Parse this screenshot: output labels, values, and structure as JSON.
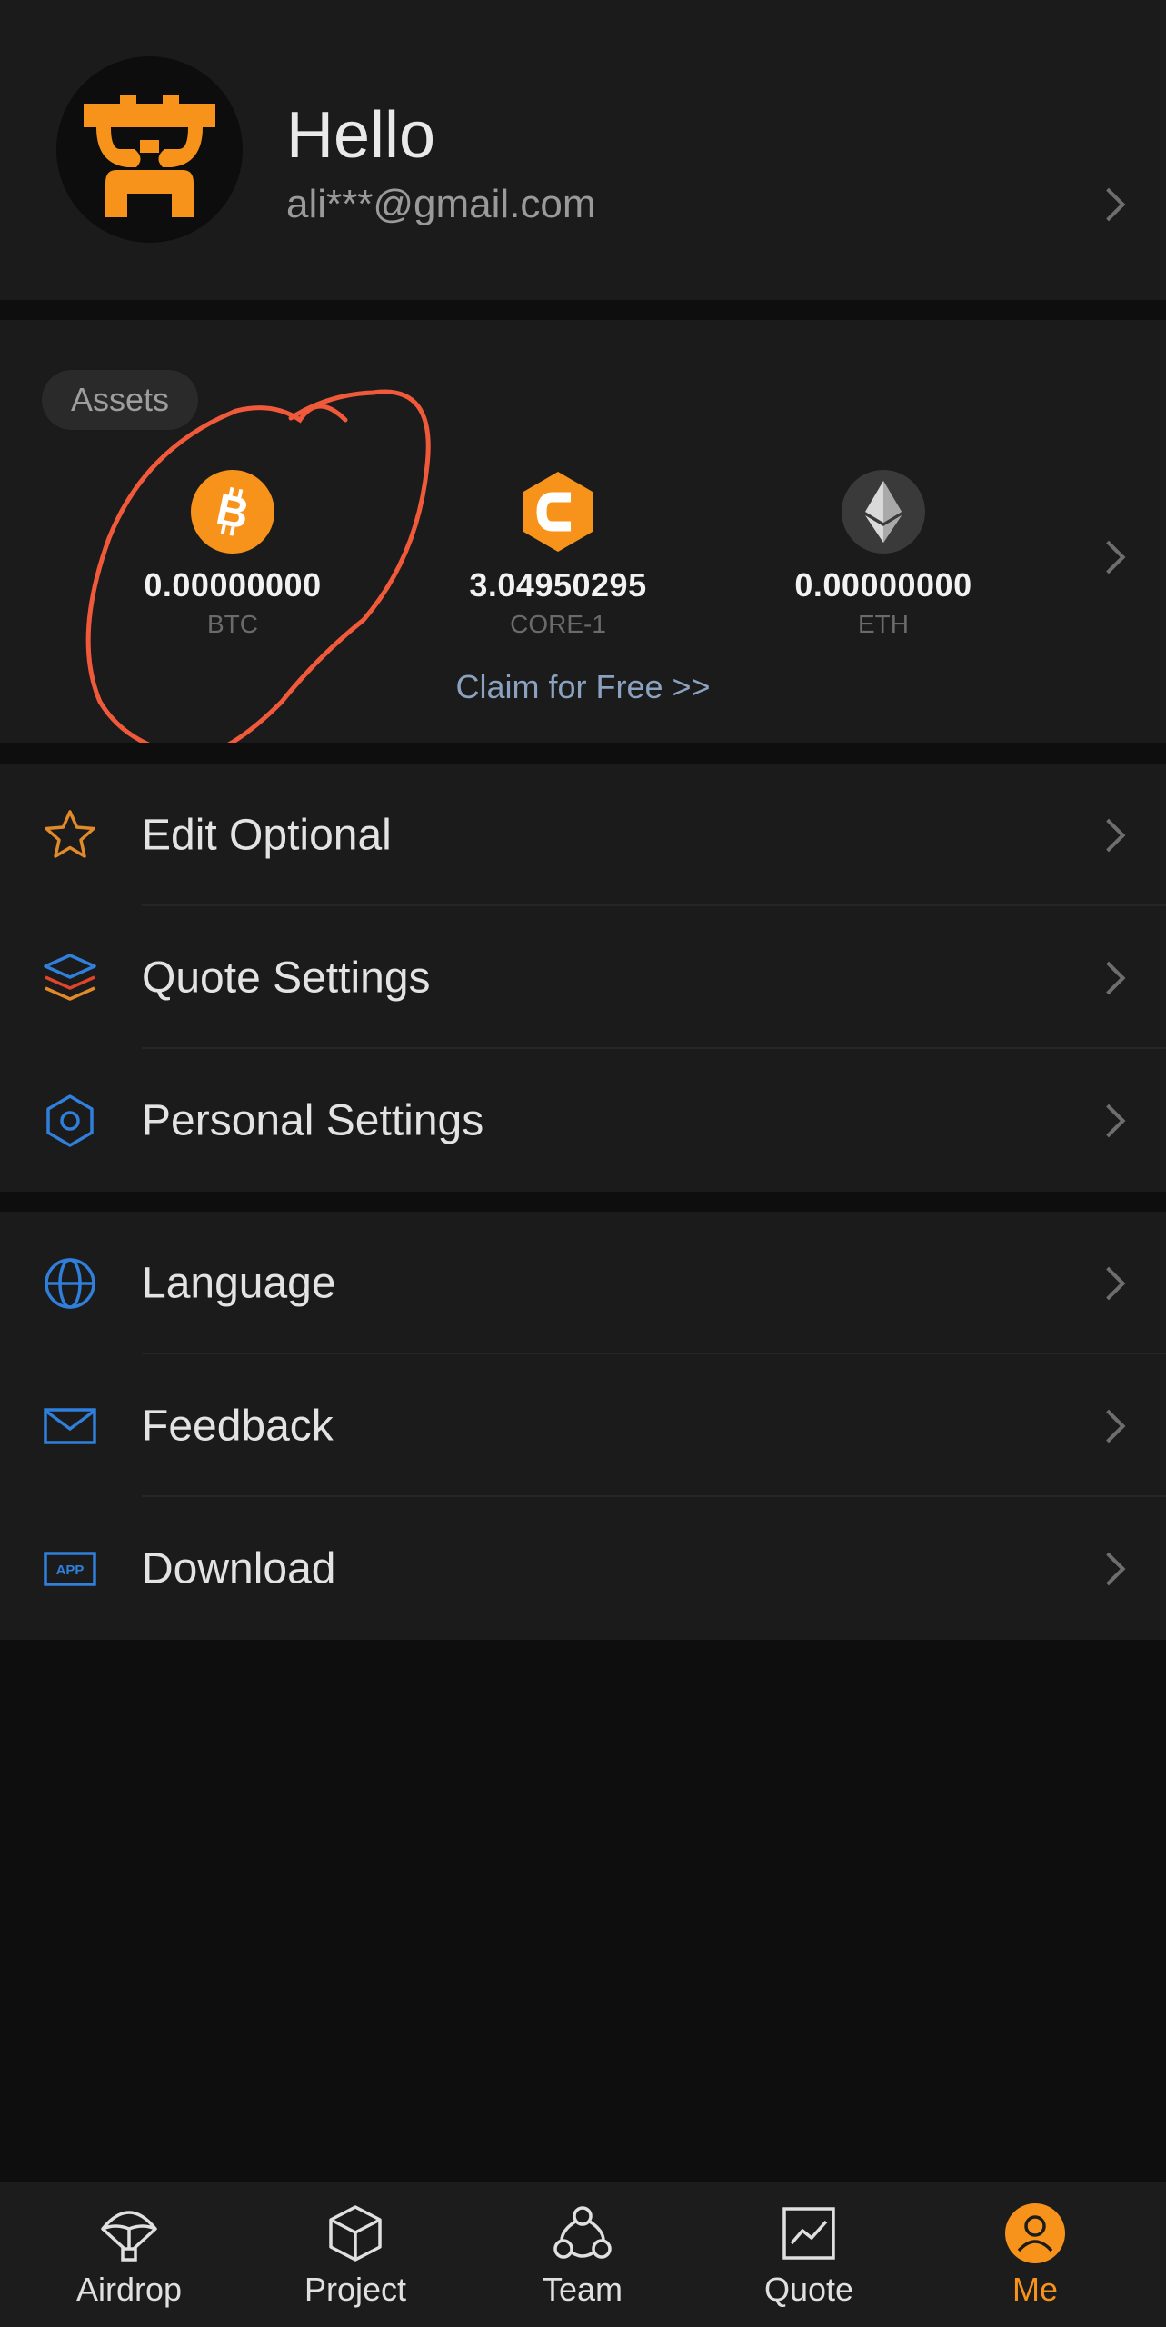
{
  "profile": {
    "greeting": "Hello",
    "email": "ali***@gmail.com"
  },
  "assets": {
    "tag": "Assets",
    "coins": [
      {
        "amount": "0.00000000",
        "symbol": "BTC",
        "icon": "bitcoin-icon",
        "color": "#f7931a"
      },
      {
        "amount": "3.04950295",
        "symbol": "CORE-1",
        "icon": "core-icon",
        "color": "#f7931a"
      },
      {
        "amount": "0.00000000",
        "symbol": "ETH",
        "icon": "ethereum-icon",
        "color": "#3a3a3a"
      }
    ],
    "claim": "Claim for Free >>"
  },
  "menu": {
    "group1": [
      {
        "label": "Edit Optional",
        "icon": "star-icon"
      },
      {
        "label": "Quote Settings",
        "icon": "layers-icon"
      },
      {
        "label": "Personal Settings",
        "icon": "hexagon-settings-icon"
      }
    ],
    "group2": [
      {
        "label": "Language",
        "icon": "globe-icon"
      },
      {
        "label": "Feedback",
        "icon": "mail-icon"
      },
      {
        "label": "Download",
        "icon": "app-icon"
      }
    ]
  },
  "nav": {
    "items": [
      {
        "label": "Airdrop",
        "icon": "parachute-icon"
      },
      {
        "label": "Project",
        "icon": "cube-icon"
      },
      {
        "label": "Team",
        "icon": "team-icon"
      },
      {
        "label": "Quote",
        "icon": "chart-icon"
      },
      {
        "label": "Me",
        "icon": "user-icon",
        "active": true
      }
    ],
    "active_color": "#f7931a"
  },
  "colors": {
    "accent": "#f7931a",
    "icon_blue": "#2f7fdb",
    "annotation": "#f05a3a"
  }
}
